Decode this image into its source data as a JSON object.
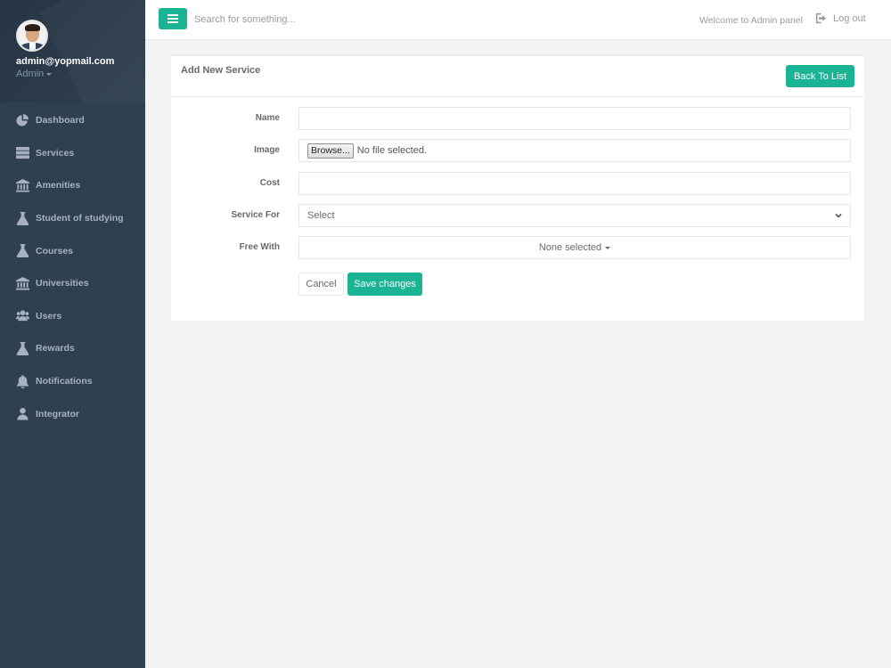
{
  "user": {
    "email": "admin@yopmail.com",
    "role": "Admin"
  },
  "nav": [
    {
      "label": "Dashboard",
      "icon": "pie-chart-icon"
    },
    {
      "label": "Services",
      "icon": "server-icon"
    },
    {
      "label": "Amenities",
      "icon": "institution-icon"
    },
    {
      "label": "Student of studying",
      "icon": "flask-icon"
    },
    {
      "label": "Courses",
      "icon": "flask-icon"
    },
    {
      "label": "Universities",
      "icon": "institution-icon"
    },
    {
      "label": "Users",
      "icon": "users-icon"
    },
    {
      "label": "Rewards",
      "icon": "flask-icon"
    },
    {
      "label": "Notifications",
      "icon": "bell-icon"
    },
    {
      "label": "Integrator",
      "icon": "user-icon"
    }
  ],
  "topbar": {
    "search_placeholder": "Search for something...",
    "welcome": "Welcome to Admin panel",
    "logout": "Log out"
  },
  "panel": {
    "title": "Add New Service",
    "back_label": "Back To List"
  },
  "form": {
    "name_label": "Name",
    "name_value": "",
    "image_label": "Image",
    "browse_label": "Browse...",
    "file_status": "No file selected.",
    "cost_label": "Cost",
    "cost_value": "",
    "service_for_label": "Service For",
    "service_for_value": "Select",
    "free_with_label": "Free With",
    "free_with_value": "None selected",
    "cancel_label": "Cancel",
    "save_label": "Save changes"
  },
  "colors": {
    "accent": "#1ab394",
    "sidebar": "#2f4050",
    "sidebar_text": "#a7b1c2"
  }
}
